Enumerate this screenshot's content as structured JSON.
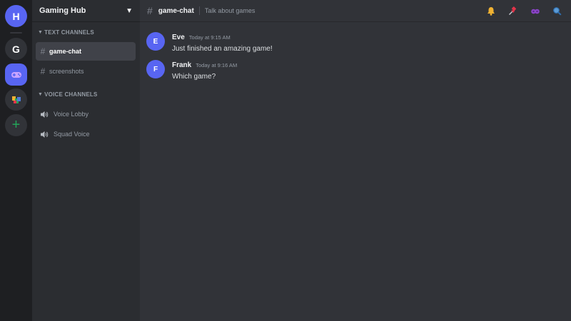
{
  "servers": {
    "home_initial": "H",
    "g_initial": "G",
    "add_symbol": "+"
  },
  "guild": {
    "name": "Gaming Hub",
    "caret": "▼"
  },
  "categories": {
    "text": "TEXT CHANNELS",
    "voice": "VOICE CHANNELS",
    "arrow": "▼"
  },
  "text_channels": [
    {
      "name": "game-chat",
      "active": true
    },
    {
      "name": "screenshots",
      "active": false
    }
  ],
  "voice_channels": [
    {
      "name": "Voice Lobby"
    },
    {
      "name": "Squad Voice"
    }
  ],
  "topbar": {
    "hash": "#",
    "channel": "game-chat",
    "topic": "Talk about games"
  },
  "messages": [
    {
      "initial": "E",
      "author": "Eve",
      "time": "Today at 9:15 AM",
      "text": "Just finished an amazing game!"
    },
    {
      "initial": "F",
      "author": "Frank",
      "time": "Today at 9:16 AM",
      "text": "Which game?"
    }
  ],
  "colors": {
    "accent": "#5865f2",
    "add_green": "#23a559",
    "bell": "#f0b232",
    "pin": "#e3344a",
    "members": "#8b45c9",
    "search": "#5b9bd5"
  },
  "icons": [
    "bell-icon",
    "pin-icon",
    "members-icon",
    "search-icon",
    "gamepad-icon",
    "speaker-icon",
    "hash-icon"
  ]
}
